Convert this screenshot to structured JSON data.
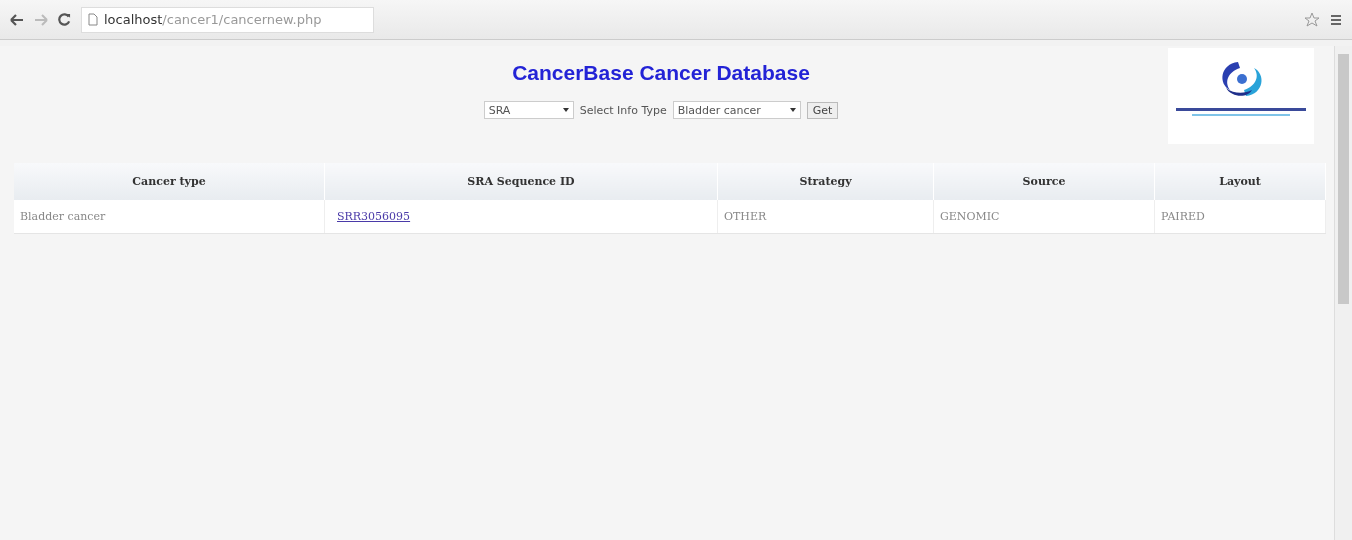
{
  "browser": {
    "url_host": "localhost",
    "url_path": "/cancer1/cancernew.php"
  },
  "page": {
    "title": "CancerBase Cancer Database",
    "form": {
      "source_select": "SRA",
      "label": "Select Info Type",
      "type_select": "Bladder cancer",
      "button": "Get"
    }
  },
  "table": {
    "columns": [
      "Cancer type",
      "SRA Sequence ID",
      "Strategy",
      "Source",
      "Layout"
    ],
    "rows": [
      {
        "cells": [
          {
            "kind": "text",
            "text": "Bladder cancer"
          },
          {
            "kind": "link",
            "text": "SRR3056095"
          },
          {
            "kind": "text",
            "text": "OTHER"
          },
          {
            "kind": "text",
            "text": "GENOMIC"
          },
          {
            "kind": "text",
            "text": "PAIRED"
          }
        ]
      }
    ]
  }
}
